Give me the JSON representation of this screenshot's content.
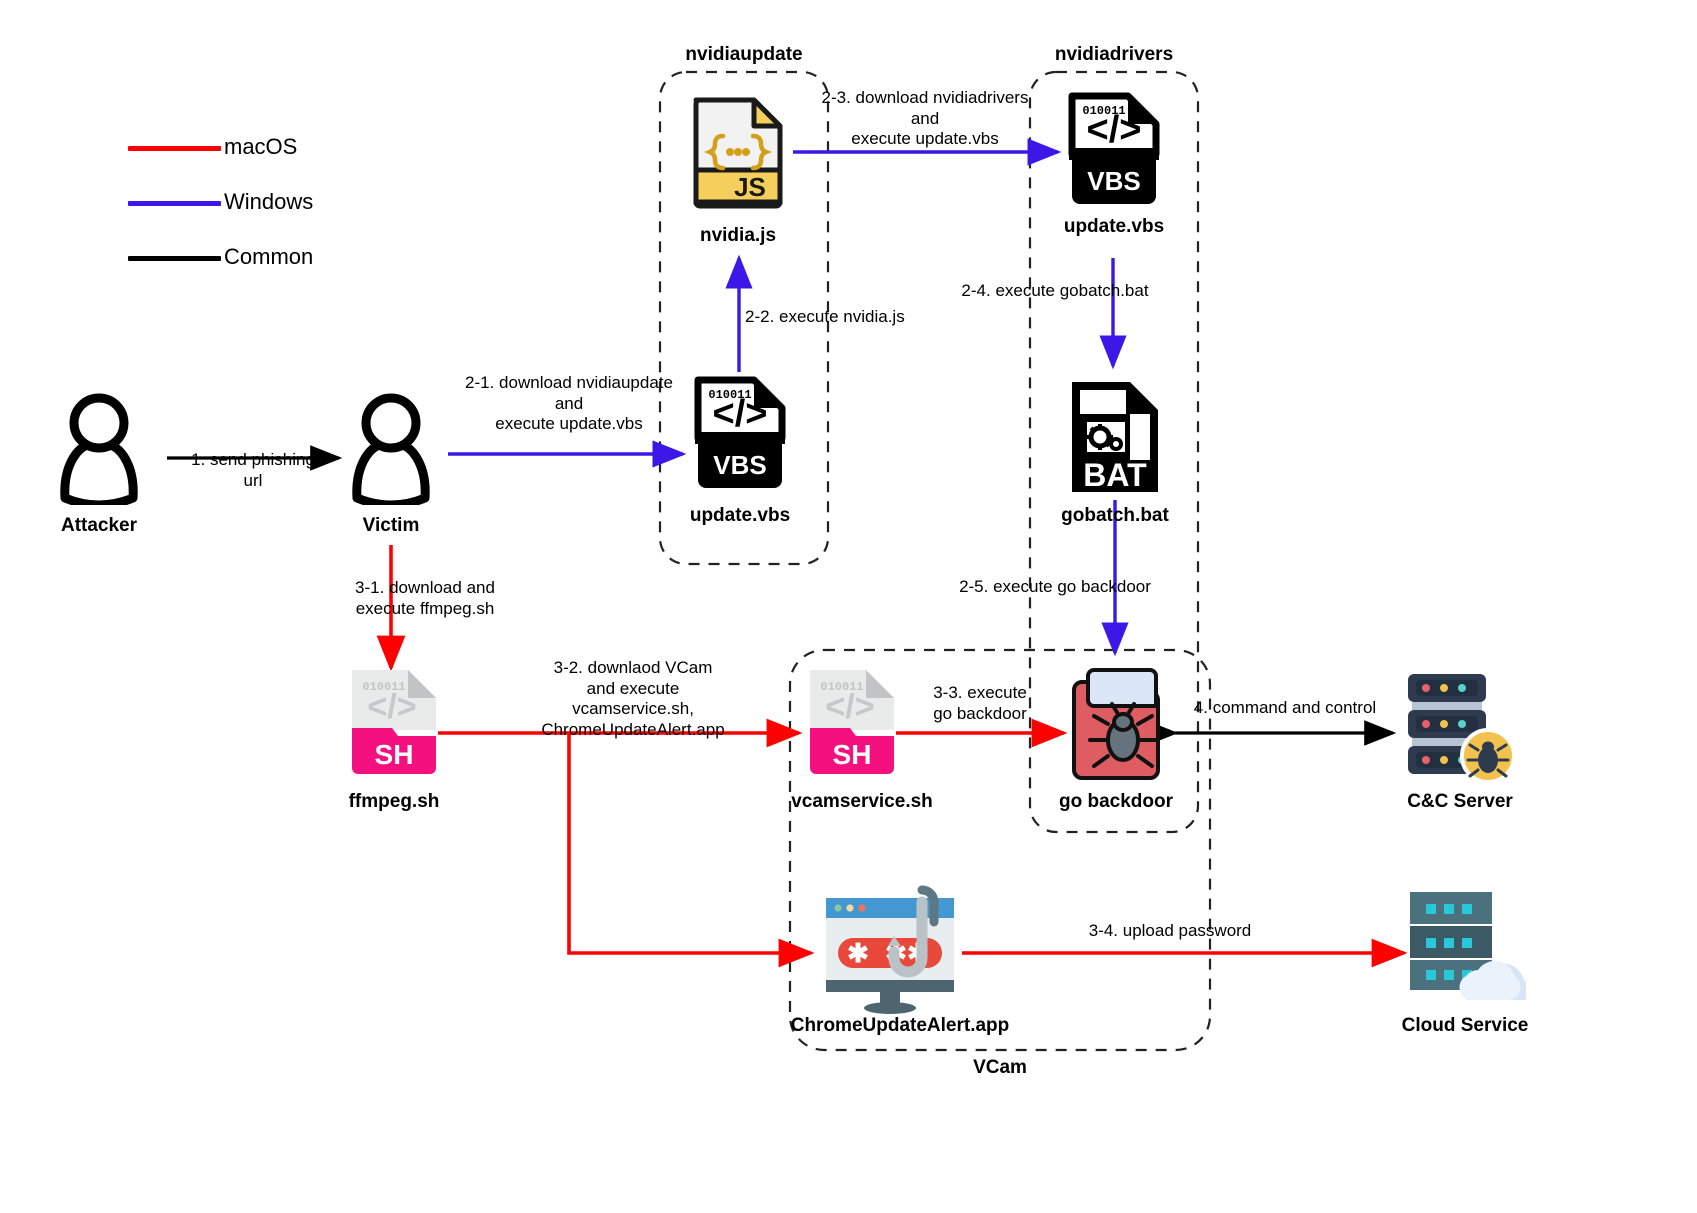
{
  "legend": {
    "items": [
      {
        "label": "macOS",
        "color": "#ff0000"
      },
      {
        "label": "Windows",
        "color": "#3b18e8"
      },
      {
        "label": "Common",
        "color": "#000000"
      }
    ]
  },
  "groups": [
    {
      "id": "nvidiaupdate",
      "label": "nvidiaupdate"
    },
    {
      "id": "nvidiadrivers",
      "label": "nvidiadrivers"
    },
    {
      "id": "vcam",
      "label": "VCam"
    }
  ],
  "nodes": [
    {
      "id": "attacker",
      "label": "Attacker",
      "icon": "person-icon"
    },
    {
      "id": "victim",
      "label": "Victim",
      "icon": "person-icon"
    },
    {
      "id": "nvidia_js",
      "label": "nvidia.js",
      "icon": "js-file-icon"
    },
    {
      "id": "update_vbs_1",
      "label": "update.vbs",
      "icon": "vbs-file-icon"
    },
    {
      "id": "update_vbs_2",
      "label": "update.vbs",
      "icon": "vbs-file-icon"
    },
    {
      "id": "gobatch_bat",
      "label": "gobatch.bat",
      "icon": "bat-file-icon"
    },
    {
      "id": "ffmpeg_sh",
      "label": "ffmpeg.sh",
      "icon": "sh-file-icon"
    },
    {
      "id": "vcamservice_sh",
      "label": "vcamservice.sh",
      "icon": "sh-file-icon"
    },
    {
      "id": "go_backdoor",
      "label": "go backdoor",
      "icon": "bug-malware-icon"
    },
    {
      "id": "chromeupdatealert_app",
      "label": "ChromeUpdateAlert.app",
      "icon": "phishing-password-icon"
    },
    {
      "id": "cc_server",
      "label": "C&C Server",
      "icon": "server-bug-icon"
    },
    {
      "id": "cloud_service",
      "label": "Cloud Service",
      "icon": "cloud-server-icon"
    }
  ],
  "edges": [
    {
      "id": "e1",
      "label": "1. send phishing\nurl",
      "type": "Common",
      "color": "#000000"
    },
    {
      "id": "e21",
      "label": "2-1. download nvidiaupdate\nand\nexecute update.vbs",
      "type": "Windows",
      "color": "#3b18e8"
    },
    {
      "id": "e22",
      "label": "2-2. execute nvidia.js",
      "type": "Windows",
      "color": "#3b18e8"
    },
    {
      "id": "e23",
      "label": "2-3. download nvidiadrivers\nand\nexecute update.vbs",
      "type": "Windows",
      "color": "#3b18e8"
    },
    {
      "id": "e24",
      "label": "2-4. execute gobatch.bat",
      "type": "Windows",
      "color": "#3b18e8"
    },
    {
      "id": "e25",
      "label": "2-5. execute go backdoor",
      "type": "Windows",
      "color": "#3b18e8"
    },
    {
      "id": "e31",
      "label": "3-1. download and\nexecute ffmpeg.sh",
      "type": "macOS",
      "color": "#ff0000"
    },
    {
      "id": "e32",
      "label": "3-2. downlaod VCam\nand execute\nvcamservice.sh,\nChromeUpdateAlert.app",
      "type": "macOS",
      "color": "#ff0000"
    },
    {
      "id": "e33",
      "label": "3-3. execute\ngo backdoor",
      "type": "macOS",
      "color": "#ff0000"
    },
    {
      "id": "e34",
      "label": "3-4. upload password",
      "type": "macOS",
      "color": "#ff0000"
    },
    {
      "id": "e4",
      "label": "4. command and control",
      "type": "Common",
      "color": "#000000"
    }
  ],
  "edge_label_lines": {
    "e1": [
      "1. send phishing",
      "url"
    ],
    "e21": [
      "2-1. download nvidiaupdate",
      "and",
      "execute update.vbs"
    ],
    "e22": [
      "2-2. execute nvidia.js"
    ],
    "e23": [
      "2-3. download nvidiadrivers",
      "and",
      "execute update.vbs"
    ],
    "e24": [
      "2-4. execute gobatch.bat"
    ],
    "e25": [
      "2-5. execute go backdoor"
    ],
    "e31": [
      "3-1. download and",
      "execute ffmpeg.sh"
    ],
    "e32": [
      "3-2. downlaod VCam",
      "and execute",
      "vcamservice.sh,",
      "ChromeUpdateAlert.app"
    ],
    "e33": [
      "3-3. execute",
      "go backdoor"
    ],
    "e34": [
      "3-4. upload password"
    ],
    "e4": [
      "4. command and control"
    ]
  },
  "icon_text": {
    "binary": "010011",
    "js": "JS",
    "vbs": "VBS",
    "bat": "BAT",
    "sh": "SH"
  },
  "colors": {
    "macos": "#ff0000",
    "windows": "#3b18e8",
    "common": "#000000",
    "js_yellow": "#f5cf5b",
    "sh_pink": "#f5107f",
    "sh_gray": "#e9eaea",
    "backdoor_red": "#de5d63",
    "backdoor_blue": "#dbe7f7",
    "server_navy": "#2e3b4e",
    "cloud_teal": "#2d5462"
  }
}
